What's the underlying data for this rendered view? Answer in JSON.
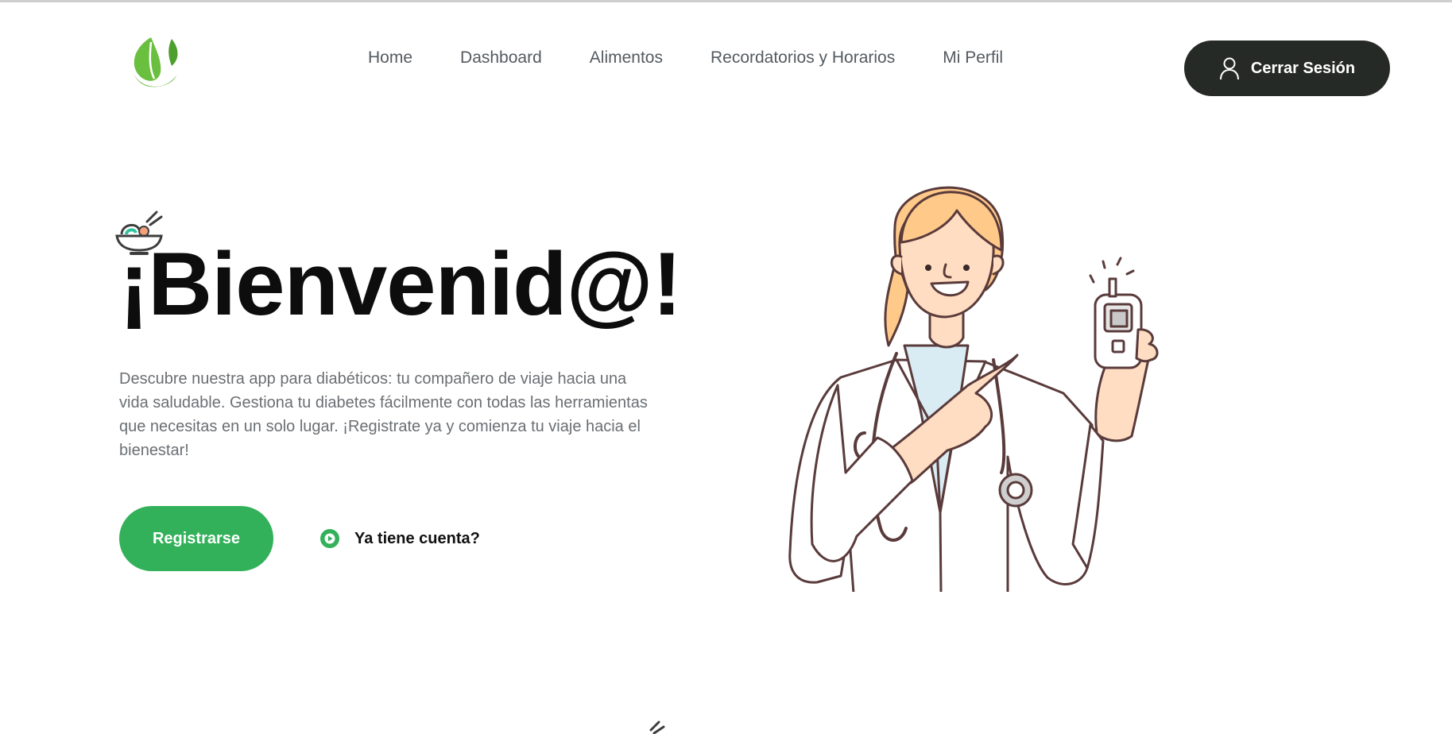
{
  "header": {
    "logo_icon": "leaf-logo-icon",
    "nav": [
      {
        "label": "Home"
      },
      {
        "label": "Dashboard"
      },
      {
        "label": "Alimentos"
      },
      {
        "label": "Recordatorios y Horarios"
      },
      {
        "label": "Mi Perfil"
      }
    ],
    "logout": {
      "label": "Cerrar Sesión",
      "icon": "user-icon"
    }
  },
  "hero": {
    "badge_icon": "food-bowl-icon",
    "title": "¡Bienvenid@!",
    "description": "Descubre nuestra app para diabéticos: tu compañero de viaje hacia una vida saludable. Gestiona tu diabetes fácilmente con todas las herramientas que necesitas en un solo lugar. ¡Registrate ya y comienza tu viaje hacia el bienestar!",
    "register_label": "Registrarse",
    "login_label": "Ya tiene cuenta?",
    "login_icon": "play-circle-icon",
    "illustration": "doctor-with-glucometer-illustration"
  },
  "colors": {
    "accent_green": "#32b15a",
    "dark_button": "#262a26",
    "nav_text": "#555a5f",
    "body_text": "#6b6f73"
  }
}
